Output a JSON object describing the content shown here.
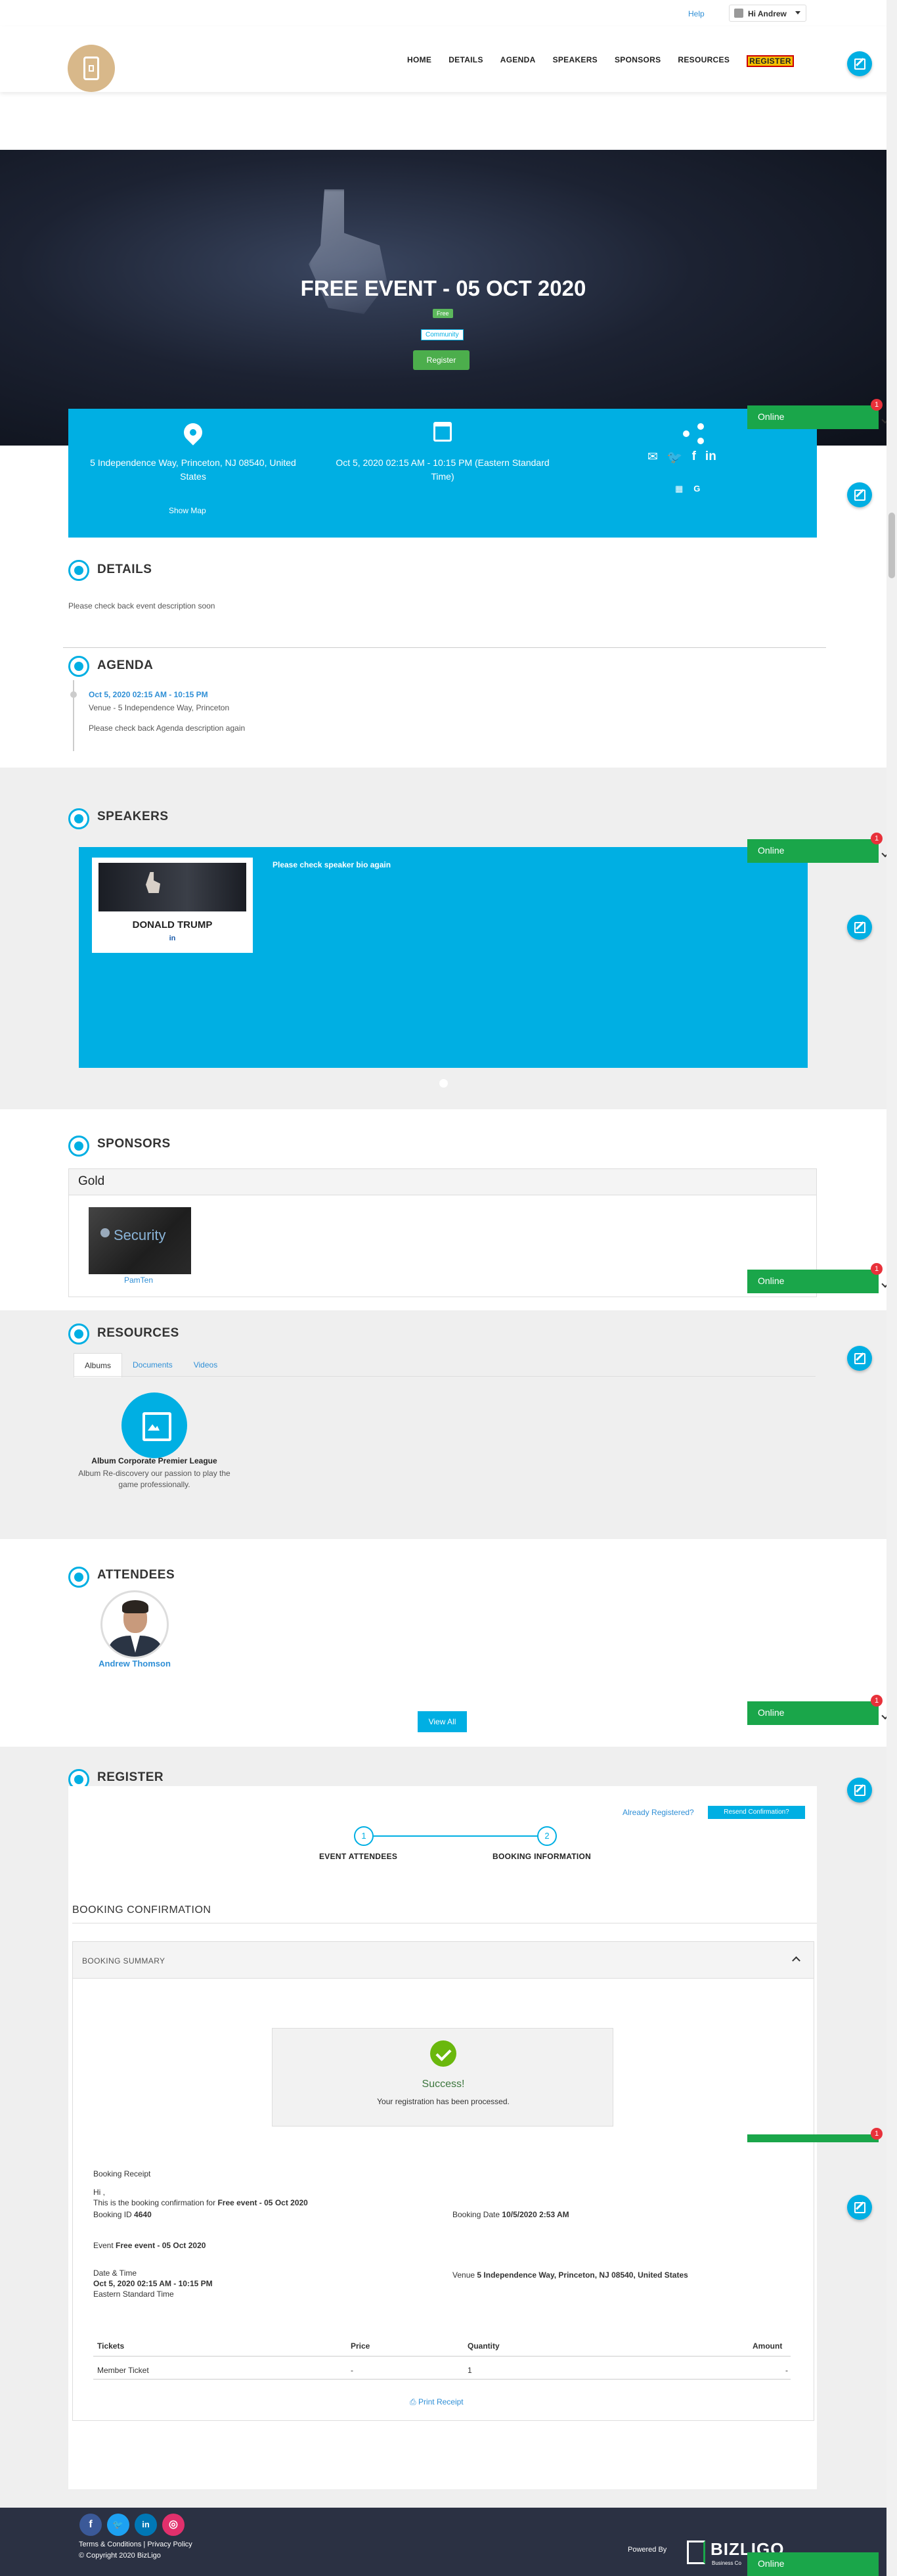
{
  "topbar": {
    "help": "Help",
    "user": "Hi Andrew"
  },
  "nav": {
    "items": [
      "HOME",
      "DETAILS",
      "AGENDA",
      "SPEAKERS",
      "SPONSORS",
      "RESOURCES"
    ],
    "register": "REGISTER"
  },
  "hero": {
    "title": "FREE EVENT - 05 OCT 2020",
    "badge_free": "Free",
    "badge_community": "Community",
    "register_button": "Register"
  },
  "info": {
    "address": "5 Independence Way, Princeton, NJ 08540, United States",
    "show_map": "Show Map",
    "datetime": "Oct 5, 2020 02:15 AM - 10:15 PM (Eastern Standard Time)",
    "calendar_google": "G"
  },
  "online": {
    "label": "Online",
    "count": "1"
  },
  "details": {
    "title": "DETAILS",
    "text": "Please check back event description soon"
  },
  "agenda": {
    "title": "AGENDA",
    "time": "Oct 5, 2020 02:15 AM - 10:15 PM",
    "venue": "Venue - 5 Independence Way, Princeton",
    "description": "Please check back Agenda description again"
  },
  "speakers": {
    "title": "SPEAKERS",
    "name": "DONALD TRUMP",
    "social": "in",
    "bio": "Please check speaker bio again"
  },
  "sponsors": {
    "title": "SPONSORS",
    "level": "Gold",
    "image_text": "Security",
    "name": "PamTen"
  },
  "resources": {
    "title": "RESOURCES",
    "tabs": [
      "Albums",
      "Documents",
      "Videos"
    ],
    "album_title": "Album Corporate Premier League",
    "album_desc": "Album Re-discovery our passion to play the game professionally."
  },
  "attendees": {
    "title": "ATTENDEES",
    "name": "Andrew Thomson",
    "view_all": "View All"
  },
  "register": {
    "title": "REGISTER",
    "already": "Already Registered?",
    "resend": "Resend Confirmation?",
    "steps": [
      {
        "num": "1",
        "label": "EVENT ATTENDEES"
      },
      {
        "num": "2",
        "label": "BOOKING INFORMATION"
      }
    ],
    "booking_confirmation": "BOOKING CONFIRMATION",
    "booking_summary": "BOOKING SUMMARY",
    "success_title": "Success!",
    "success_msg": "Your registration has been processed.",
    "receipt": {
      "heading": "Booking Receipt",
      "hi": "Hi ,",
      "confirm_prefix": "This is the booking confirmation for",
      "event_name": "Free event - 05 Oct 2020",
      "booking_id_label": "Booking ID",
      "booking_id": "4640",
      "booking_date_label": "Booking Date",
      "booking_date": "10/5/2020 2:53 AM",
      "event_label": "Event",
      "event_value": "Free event - 05 Oct 2020",
      "datetime_label": "Date & Time",
      "datetime_value": "Oct 5, 2020 02:15 AM - 10:15 PM",
      "timezone": "Eastern Standard Time",
      "venue_label": "Venue",
      "venue_value": "5 Independence Way, Princeton, NJ 08540, United States"
    },
    "table": {
      "headers": [
        "Tickets",
        "Price",
        "Quantity",
        "Amount"
      ],
      "row": [
        "Member Ticket",
        "-",
        "1",
        "-"
      ]
    },
    "print": "Print Receipt"
  },
  "footer": {
    "links": "Terms & Conditions | Privacy Policy",
    "copyright": "© Copyright 2020 BizLigo",
    "powered": "Powered By",
    "brand": "BIZLIGO",
    "brand_sub": "Business Co"
  }
}
